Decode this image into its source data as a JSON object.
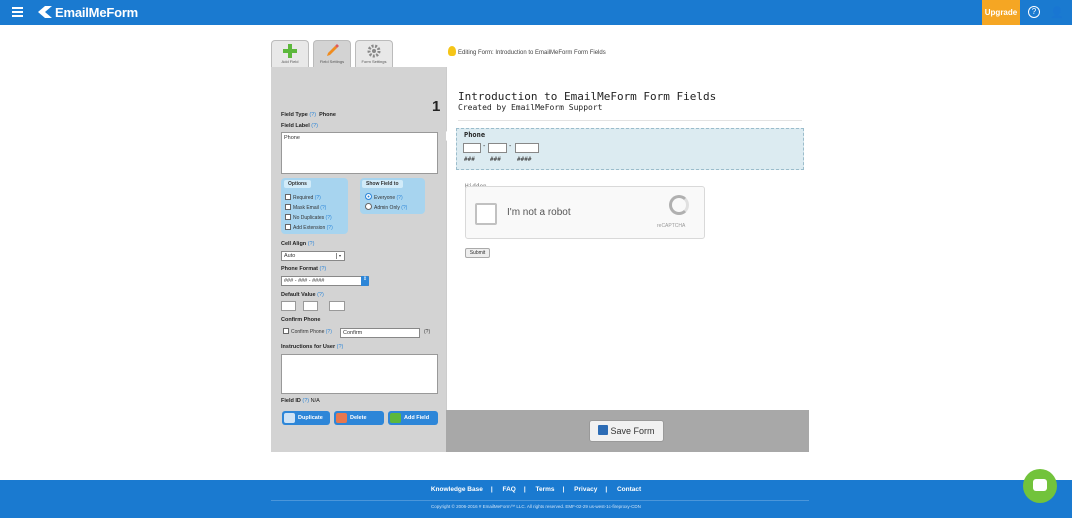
{
  "header": {
    "logo_text": "EmailMeForm",
    "upgrade_label": "Upgrade"
  },
  "tabs": [
    {
      "label": "Add Field"
    },
    {
      "label": "Field Settings"
    },
    {
      "label": "Form Settings"
    }
  ],
  "editing_note": "Editing Form: Introduction to EmailMeForm Form Fields",
  "field_settings": {
    "field_number": "1",
    "field_type_label": "Field Type",
    "field_type_value": "Phone",
    "field_label_label": "Field Label",
    "field_label_value": "Phone",
    "help_mark": "(?)",
    "options_title": "Options",
    "options": [
      "Required",
      "Mask Email",
      "No Duplicates",
      "Add Extension"
    ],
    "show_field_title": "Show Field to",
    "show_field_options": [
      "Everyone",
      "Admin Only"
    ],
    "cell_align_label": "Cell Align",
    "cell_align_value": "Auto",
    "phone_format_label": "Phone Format",
    "phone_format_value": "### - ### - ####",
    "default_value_label": "Default Value",
    "confirm_phone_label": "Confirm Phone",
    "confirm_phone_checkbox": "Confirm Phone",
    "confirm_phone_value": "Confirm",
    "instructions_label": "Instructions for User",
    "field_id_label": "Field ID",
    "field_id_value": "N/A",
    "duplicate_label": "Duplicate",
    "delete_label": "Delete",
    "add_field_label": "Add Field"
  },
  "form_preview": {
    "title": "Introduction to EmailMeForm Form Fields",
    "subtitle": "Created by EmailMeForm Support",
    "phone_label": "Phone",
    "phone_hints": [
      "###",
      "###",
      "####"
    ],
    "hidden_label": "Hidden",
    "captcha_text": "I'm not a robot",
    "captcha_brand": "reCAPTCHA",
    "submit_label": "Submit"
  },
  "save_label": "Save Form",
  "footer": {
    "links": [
      "Knowledge Base",
      "FAQ",
      "Terms",
      "Privacy",
      "Contact"
    ],
    "separator": "|",
    "copyright": "Copyright © 2006-2016 # EmailMeForm™ LLC. All rights reserved. EMF-02-29 us-west-1c-fireproxy-CDN"
  }
}
